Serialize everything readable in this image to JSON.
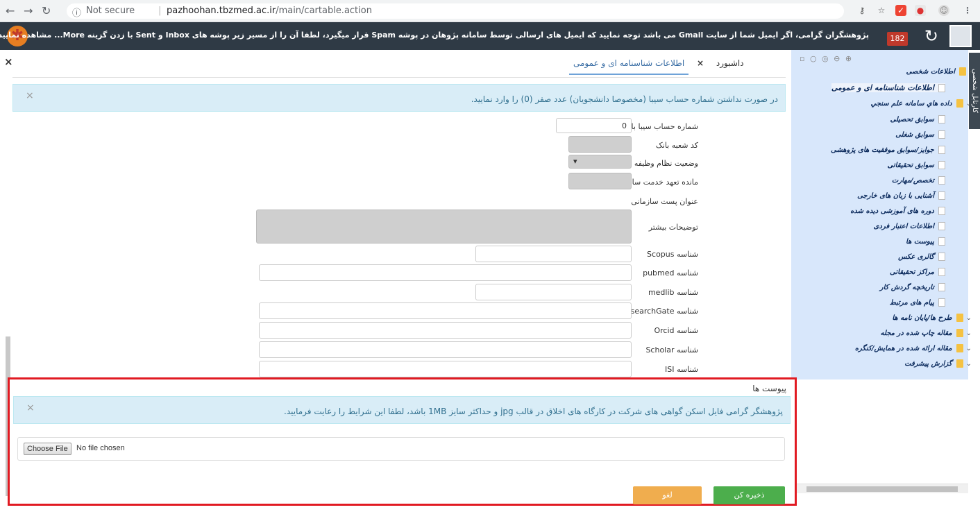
{
  "browser": {
    "info_icon": "info-icon",
    "not_secure": "Not secure",
    "separator": "|",
    "url_host": "pazhoohan.tbzmed.ac.ir",
    "url_path": "/main/cartable.action"
  },
  "header": {
    "notice": "پژوهشگران گرامی، اگر ایمیل شما از سایت Gmail می باشد توجه نمایید که ایمیل های ارسالی توسط سامانه پژوهان در پوشه Spam قرار میگیرد، لطفا آن را از مسیر زیر پوشه های Inbox و Sent با زدن گزینه More... مشاهده نمایید.",
    "badge_count": "182"
  },
  "sidebar": {
    "vertical_tab": "کارتابل شخصی",
    "items": [
      {
        "label": "اطلاعات شخصی"
      },
      {
        "label": "اطلاعات شناسنامه ای و عمومی"
      },
      {
        "label": "داده هاي سامانه علم سنجي"
      },
      {
        "label": "سوابق تحصیلی"
      },
      {
        "label": "سوابق شغلی"
      },
      {
        "label": "جوایز/سوابق موفقیت های پژوهشی"
      },
      {
        "label": "سوابق تحقیقاتی"
      },
      {
        "label": "تخصص/مهارت"
      },
      {
        "label": "آشنایی با زبان های خارجی"
      },
      {
        "label": "دوره های آموزشی دیده شده"
      },
      {
        "label": "اطلاعات اعتبار فردی"
      },
      {
        "label": "پیوست ها"
      },
      {
        "label": "گالری عکس"
      },
      {
        "label": "مراکز تحقیقاتی"
      },
      {
        "label": "تاریخچه گردش کار"
      },
      {
        "label": "پیام های مرتبط"
      },
      {
        "label": "طرح ها/پایان نامه ها"
      },
      {
        "label": "مقاله چاپ شده در مجله"
      },
      {
        "label": "مقاله ارائه شده در همایش/کنگره"
      },
      {
        "label": "گزارش پیشرفت"
      }
    ]
  },
  "tabs": {
    "dashboard": "داشبورد",
    "close": "×",
    "active": "اطلاعات شناسنامه ای و عمومی"
  },
  "main": {
    "close": "×",
    "alert_text": "در صورت نداشتن شماره حساب سیبا (مخصوصا دانشجویان) عدد صفر (0) را وارد نمایید.",
    "alert_close": "×",
    "fields": {
      "bank_account_label": "شماره حساب سیبا بانک ملی",
      "bank_account_value": "0",
      "branch_code_label": "کد شعبه بانک",
      "military_label": "وضعیت نظام وظیفه",
      "military_arrow": "▾",
      "service_remaining_label": "مانده تعهد خدمت سال",
      "org_title_label": "عنوان پست سازمانی",
      "more_desc_label": "توضیحات بیشتر",
      "scopus_label": "شناسه Scopus",
      "pubmed_label": "شناسه pubmed",
      "medlib_label": "شناسه medlib",
      "researchgate_label": "شناسه ResearchGate",
      "orcid_label": "شناسه Orcid",
      "scholar_label": "شناسه Scholar",
      "isi_label": "شناسه ISI"
    }
  },
  "attachments": {
    "title": "پیوست ها",
    "alert_text": "پژوهشگر گرامی فایل اسکن گواهی های شرکت در کارگاه های اخلاق در قالب jpg و حداکثر سایز 1MB باشد، لطفا این شرایط را رعایت فرمایید.",
    "alert_close": "×",
    "choose_file": "Choose File",
    "file_status": "No file chosen",
    "save": "ذخیره کن",
    "cancel": "لغو"
  }
}
